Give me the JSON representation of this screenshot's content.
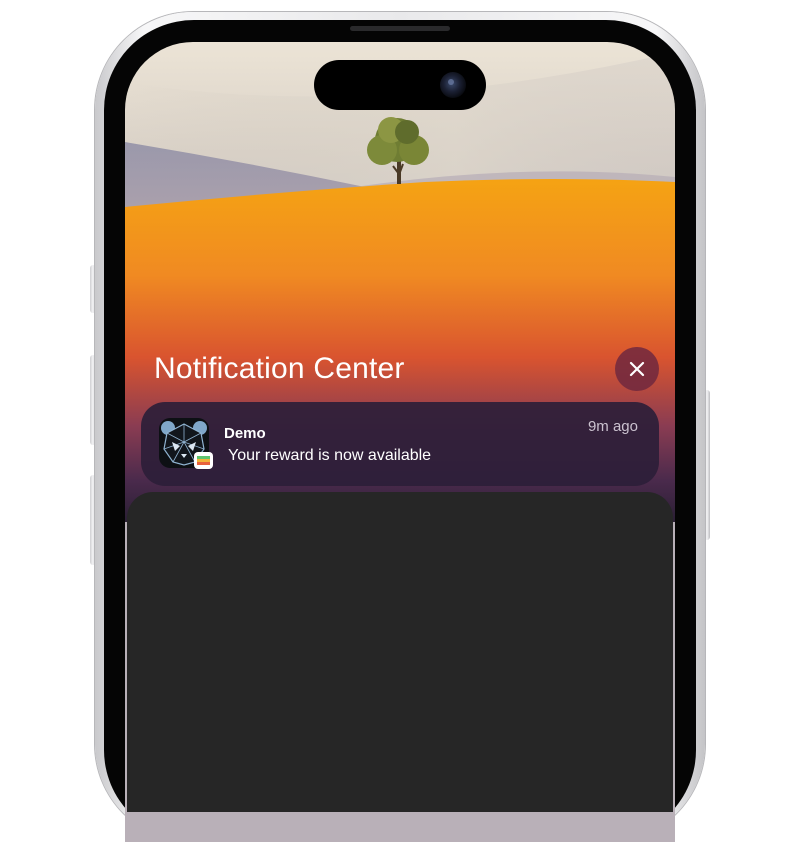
{
  "notification_center": {
    "title": "Notification Center",
    "close_icon": "close-icon"
  },
  "notifications": [
    {
      "app_name": "Demo",
      "message": "Your reward is now available",
      "time": "9m ago",
      "icon": "panda-app-icon",
      "badge_icon": "wallet-icon"
    }
  ],
  "colors": {
    "dune_orange": "#f2921c",
    "card_background": "#2c1e38",
    "close_button": "#70283e",
    "lower_panel": "#262626"
  }
}
